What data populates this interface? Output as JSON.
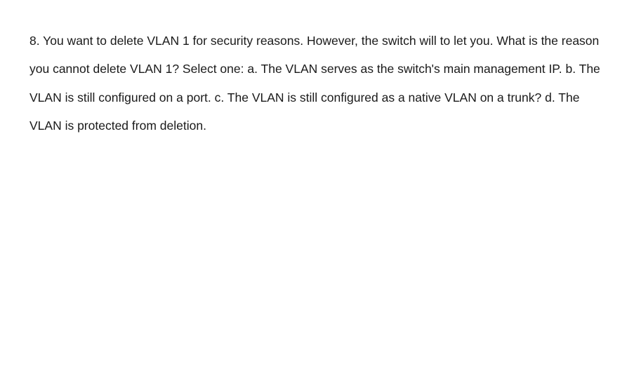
{
  "question": {
    "number": "8.",
    "stem_part1": "You want to delete VLAN 1 for security reasons. However, the switch will to let you. What is the reason you cannot delete VLAN 1? Select one:",
    "option_a_label": "a.",
    "option_a_text": "The VLAN serves as the switch's main management IP.",
    "option_b_label": "b.",
    "option_b_text": "The VLAN is still configured on a port.",
    "option_c_label": "c.",
    "option_c_text": "The VLAN is still configured as a native VLAN on a trunk?",
    "option_d_label": "d.",
    "option_d_text": "The VLAN is protected from deletion."
  }
}
